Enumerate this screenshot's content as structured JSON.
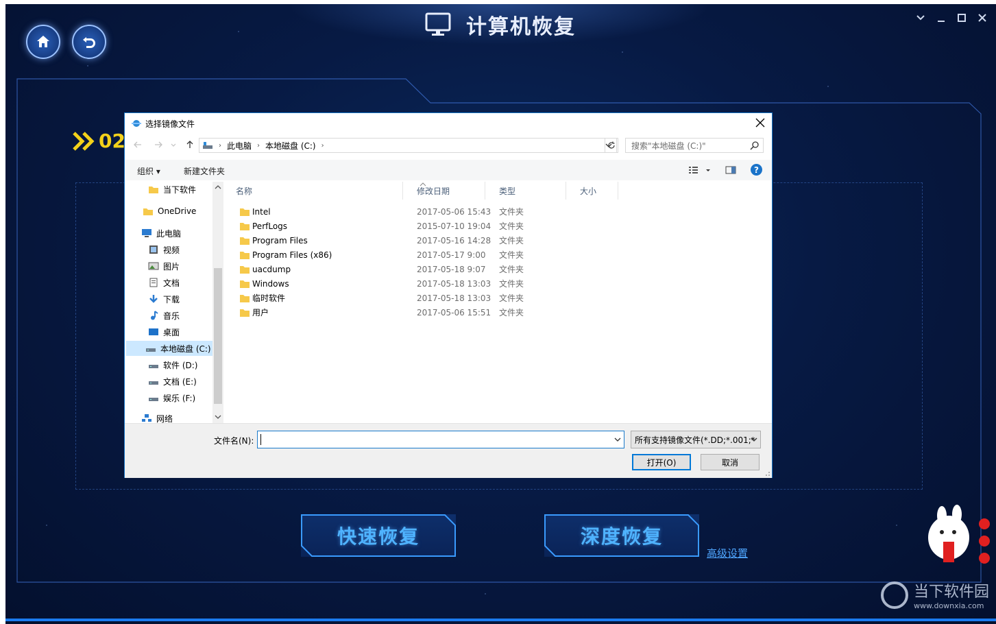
{
  "app": {
    "title": "计算机恢复",
    "step": "02",
    "quick_recover": "快速恢复",
    "deep_recover": "深度恢复",
    "advanced_settings": "高级设置",
    "watermark_cn": "当下软件园",
    "watermark_url": "www.downxia.com",
    "accent_color": "#4fb3ff",
    "step_color": "#f3d11a"
  },
  "dialog": {
    "title": "选择镜像文件",
    "breadcrumb": [
      "此电脑",
      "本地磁盘 (C:)"
    ],
    "search_placeholder": "搜索\"本地磁盘 (C:)\"",
    "toolbar": {
      "organize": "组织 ▾",
      "new_folder": "新建文件夹"
    },
    "columns": [
      "名称",
      "修改日期",
      "类型",
      "大小"
    ],
    "tree": [
      {
        "label": "当下软件",
        "icon": "folder-icon"
      },
      {
        "label": "OneDrive",
        "icon": "folder-icon"
      },
      {
        "label": "此电脑",
        "icon": "computer-icon"
      },
      {
        "label": "视频",
        "icon": "video-icon"
      },
      {
        "label": "图片",
        "icon": "picture-icon"
      },
      {
        "label": "文档",
        "icon": "document-icon"
      },
      {
        "label": "下载",
        "icon": "download-icon"
      },
      {
        "label": "音乐",
        "icon": "music-icon"
      },
      {
        "label": "桌面",
        "icon": "desktop-icon"
      },
      {
        "label": "本地磁盘 (C:)",
        "icon": "drive-icon"
      },
      {
        "label": "软件 (D:)",
        "icon": "drive-icon"
      },
      {
        "label": "文档 (E:)",
        "icon": "drive-icon"
      },
      {
        "label": "娱乐 (F:)",
        "icon": "drive-icon"
      },
      {
        "label": "网络",
        "icon": "network-icon"
      }
    ],
    "files": [
      {
        "name": "Intel",
        "date": "2017-05-06 15:43",
        "type": "文件夹"
      },
      {
        "name": "PerfLogs",
        "date": "2015-07-10 19:04",
        "type": "文件夹"
      },
      {
        "name": "Program Files",
        "date": "2017-05-16 14:28",
        "type": "文件夹"
      },
      {
        "name": "Program Files (x86)",
        "date": "2017-05-17 9:00",
        "type": "文件夹"
      },
      {
        "name": "uacdump",
        "date": "2017-05-18 9:07",
        "type": "文件夹"
      },
      {
        "name": "Windows",
        "date": "2017-05-18 13:03",
        "type": "文件夹"
      },
      {
        "name": "临时软件",
        "date": "2017-05-18 13:03",
        "type": "文件夹"
      },
      {
        "name": "用户",
        "date": "2017-05-06 15:51",
        "type": "文件夹"
      }
    ],
    "filename_label": "文件名(N):",
    "filename_value": "",
    "filter": "所有支持镜像文件(*.DD;*.001;*",
    "open_button": "打开(O)",
    "cancel_button": "取消"
  }
}
